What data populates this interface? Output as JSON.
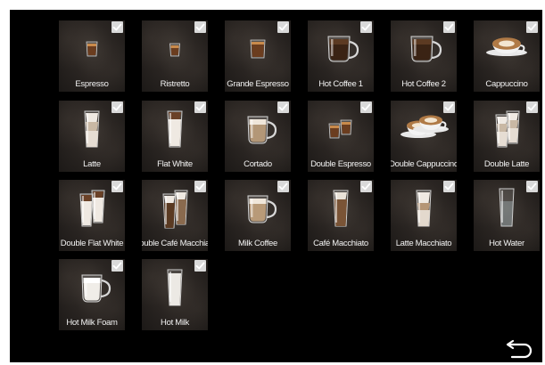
{
  "drinks": [
    {
      "label": "Espresso",
      "icon": "espresso-cup-icon",
      "selected": true
    },
    {
      "label": "Ristretto",
      "icon": "ristretto-cup-icon",
      "selected": true
    },
    {
      "label": "Grande Espresso",
      "icon": "grande-espresso-cup-icon",
      "selected": true
    },
    {
      "label": "Hot Coffee 1",
      "icon": "coffee-mug-icon",
      "selected": true
    },
    {
      "label": "Hot Coffee 2",
      "icon": "coffee-mug-icon",
      "selected": true
    },
    {
      "label": "Cappuccino",
      "icon": "cappuccino-cup-icon",
      "selected": true
    },
    {
      "label": "Latte",
      "icon": "latte-glass-icon",
      "selected": true
    },
    {
      "label": "Flat White",
      "icon": "flat-white-glass-icon",
      "selected": true
    },
    {
      "label": "Cortado",
      "icon": "cortado-glass-icon",
      "selected": true
    },
    {
      "label": "Double Espresso",
      "icon": "double-espresso-cups-icon",
      "selected": true
    },
    {
      "label": "Double Cappuccino",
      "icon": "double-cappuccino-cups-icon",
      "selected": true
    },
    {
      "label": "Double Latte",
      "icon": "double-latte-glasses-icon",
      "selected": true
    },
    {
      "label": "Double Flat White",
      "icon": "double-flat-white-glasses-icon",
      "selected": true
    },
    {
      "label": "Double Café Macchiato",
      "icon": "double-macchiato-glasses-icon",
      "selected": true
    },
    {
      "label": "Milk Coffee",
      "icon": "milk-coffee-mug-icon",
      "selected": true
    },
    {
      "label": "Café Macchiato",
      "icon": "cafe-macchiato-glass-icon",
      "selected": true
    },
    {
      "label": "Latte Macchiato",
      "icon": "latte-macchiato-glass-icon",
      "selected": true
    },
    {
      "label": "Hot Water",
      "icon": "hot-water-glass-icon",
      "selected": true
    },
    {
      "label": "Hot Milk Foam",
      "icon": "milk-foam-mug-icon",
      "selected": true
    },
    {
      "label": "Hot Milk",
      "icon": "hot-milk-glass-icon",
      "selected": true
    }
  ],
  "back": {
    "icon": "back-arrow-icon"
  },
  "colors": {
    "screen_bg": "#000000",
    "tile_bg": "#2a2522",
    "check_bg": "#d9d9d9",
    "label": "#f2f2f2",
    "coffee": "#5a3a22",
    "milk": "#efe9e2"
  }
}
